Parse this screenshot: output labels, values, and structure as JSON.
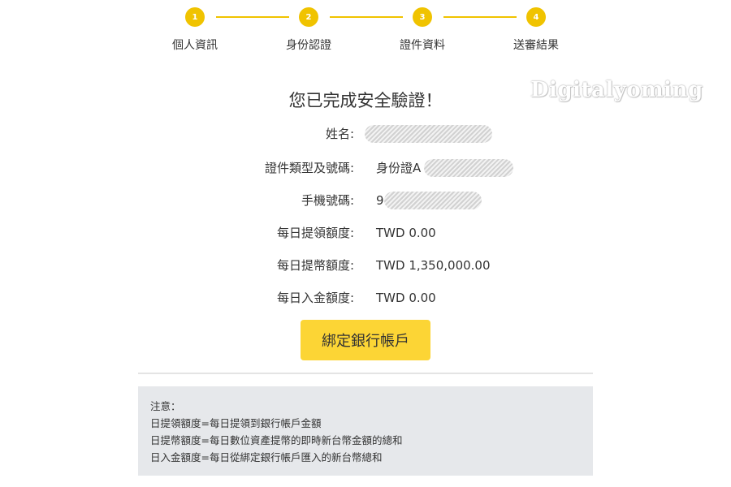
{
  "stepper": {
    "steps": [
      {
        "number": "1",
        "label": "個人資訊"
      },
      {
        "number": "2",
        "label": "身份認證"
      },
      {
        "number": "3",
        "label": "證件資料"
      },
      {
        "number": "4",
        "label": "送審結果"
      }
    ],
    "color": "#f0c300"
  },
  "watermark": "Digitalyoming",
  "result": {
    "title": "您已完成安全驗證！",
    "fields": [
      {
        "label": "姓名:",
        "value": ""
      },
      {
        "label": "證件類型及號碼:",
        "value": "身份證A"
      },
      {
        "label": "手機號碼:",
        "value": "9"
      },
      {
        "label": "每日提領額度:",
        "value": "TWD 0.00"
      },
      {
        "label": "每日提幣額度:",
        "value": "TWD 1,350,000.00"
      },
      {
        "label": "每日入金額度:",
        "value": "TWD 0.00"
      }
    ]
  },
  "actions": {
    "bind_bank_label": "綁定銀行帳戶",
    "accent": "#fcd535"
  },
  "notes": {
    "heading": "注意：",
    "lines": [
      "日提領額度=每日提領到銀行帳戶金額",
      "日提幣額度=每日數位資產提幣的即時新台幣金額的總和",
      "日入金額度=每日從綁定銀行帳戶匯入的新台幣總和"
    ]
  }
}
